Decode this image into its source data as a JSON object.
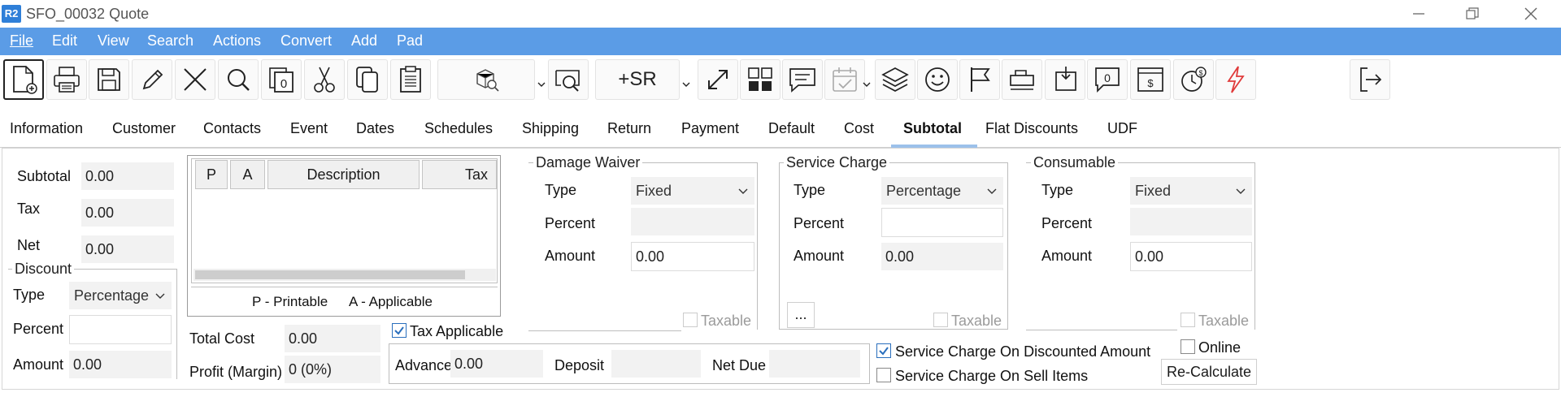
{
  "window": {
    "app_badge": "R2",
    "title": "SFO_00032 Quote"
  },
  "menu": [
    "File",
    "Edit",
    "View",
    "Search",
    "Actions",
    "Convert",
    "Add",
    "Pad"
  ],
  "toolbar": {
    "sr_label": "+SR"
  },
  "tabs": [
    "Information",
    "Customer",
    "Contacts",
    "Event",
    "Dates",
    "Schedules",
    "Shipping",
    "Return",
    "Payment",
    "Default",
    "Cost",
    "Subtotal",
    "Flat Discounts",
    "UDF"
  ],
  "active_tab": "Subtotal",
  "summary": {
    "subtotal_label": "Subtotal",
    "subtotal_value": "0.00",
    "tax_label": "Tax",
    "tax_value": "0.00",
    "net_label": "Net",
    "net_value": "0.00"
  },
  "discount": {
    "title": "Discount",
    "type_label": "Type",
    "type_value": "Percentage",
    "percent_label": "Percent",
    "percent_value": "",
    "amount_label": "Amount",
    "amount_value": "0.00"
  },
  "tax_grid": {
    "columns": [
      "P",
      "A",
      "Description",
      "Tax"
    ],
    "legend_p": "P - Printable",
    "legend_a": "A - Applicable"
  },
  "cost": {
    "total_cost_label": "Total Cost",
    "total_cost_value": "0.00",
    "profit_label": "Profit (Margin)",
    "profit_value": "0 (0%)"
  },
  "tax_applicable": {
    "label": "Tax Applicable",
    "checked": true
  },
  "payment": {
    "advance_label": "Advance",
    "advance_value": "0.00",
    "deposit_label": "Deposit",
    "deposit_value": "",
    "net_due_label": "Net Due",
    "net_due_value": ""
  },
  "damage_waiver": {
    "title": "Damage  Waiver",
    "type_label": "Type",
    "type_value": "Fixed",
    "percent_label": "Percent",
    "percent_value": "",
    "amount_label": "Amount",
    "amount_value": "0.00",
    "taxable_label": "Taxable"
  },
  "service_charge": {
    "title": "Service Charge",
    "type_label": "Type",
    "type_value": "Percentage",
    "percent_label": "Percent",
    "percent_value": "",
    "amount_label": "Amount",
    "amount_value": "0.00",
    "taxable_label": "Taxable",
    "more_label": "..."
  },
  "consumable": {
    "title": "Consumable",
    "type_label": "Type",
    "type_value": "Fixed",
    "percent_label": "Percent",
    "percent_value": "",
    "amount_label": "Amount",
    "amount_value": "0.00",
    "taxable_label": "Taxable"
  },
  "options": {
    "sc_discounted_label": "Service Charge On Discounted Amount",
    "sc_discounted_checked": true,
    "sc_sell_items_label": "Service Charge On Sell Items",
    "sc_sell_items_checked": false,
    "online_label": "Online",
    "online_checked": false,
    "recalc_label": "Re-Calculate"
  },
  "colors": {
    "menubar": "#5b9ce6",
    "tab_underline": "#9cc1ea",
    "badge": "#2f7fd8",
    "check": "#2a6fbd"
  }
}
